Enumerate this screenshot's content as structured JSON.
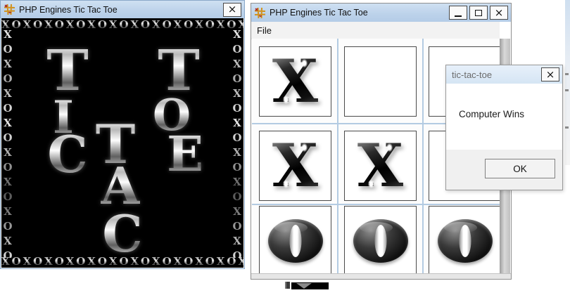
{
  "left_window": {
    "title": "PHP Engines Tic Tac Toe",
    "splash": {
      "border_top": "XOXOXOXOXOXOXOXOXOXOXOXO",
      "border_bottom": "XOXOXOXOXOXOXOXOXOXOXOXO",
      "border_left": "XOXOXOXOXOXOXOXOXOXO",
      "border_right": "XOXOXOXOXOXOXOXOXOXO",
      "letters": [
        {
          "ch": "T"
        },
        {
          "ch": "T"
        },
        {
          "ch": "I"
        },
        {
          "ch": "O"
        },
        {
          "ch": "C"
        },
        {
          "ch": "T"
        },
        {
          "ch": "E"
        },
        {
          "ch": "A"
        },
        {
          "ch": "C"
        }
      ]
    }
  },
  "game_window": {
    "title": "PHP Engines Tic Tac Toe",
    "menu_items": [
      {
        "label": "File"
      }
    ],
    "board": [
      [
        "X",
        "",
        ""
      ],
      [
        "X",
        "X",
        ""
      ],
      [
        "O",
        "O",
        "O"
      ]
    ]
  },
  "dialog": {
    "title": "tic-tac-toe",
    "message": "Computer Wins",
    "ok_label": "OK"
  },
  "icons": {
    "close": "×",
    "minimize": "–",
    "maximize": "□",
    "app": "tic-tac-toe-grid"
  },
  "colors": {
    "titlebar_blue": "#bcd2ea",
    "dialog_titlebar": "#d5e5f4",
    "grid_line_blue": "#b3cbe2",
    "splash_background": "#000000",
    "icon_gold": "#d2921e",
    "icon_red": "#a82222"
  }
}
